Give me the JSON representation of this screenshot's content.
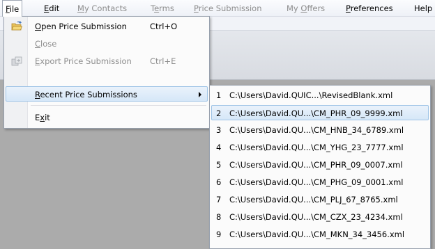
{
  "menubar": {
    "items": [
      {
        "label": "File",
        "underline": "F",
        "rest": "ile",
        "state": "open"
      },
      {
        "label": "Edit",
        "underline": "E",
        "rest": "dit",
        "state": "enabled"
      },
      {
        "label": "My Contacts",
        "underline": "M",
        "rest": "y Contacts",
        "state": "disabled"
      },
      {
        "label": "Terms",
        "underline": "e",
        "pre": "T",
        "rest": "rms",
        "state": "disabled"
      },
      {
        "label": "Price Submission",
        "underline": "P",
        "rest": "rice Submission",
        "state": "disabled"
      },
      {
        "label": "My Offers",
        "pre": "My ",
        "underline": "O",
        "rest": "ffers",
        "state": "disabled"
      },
      {
        "label": "Preferences",
        "underline": "P",
        "rest": "references",
        "state": "enabled"
      },
      {
        "label": "Help",
        "underline": "",
        "rest": "Help",
        "state": "enabled"
      }
    ]
  },
  "file_menu": {
    "open": {
      "underline": "O",
      "rest": "pen Price Submission",
      "shortcut": "Ctrl+O",
      "icon": "open-folder-icon",
      "enabled": true
    },
    "close": {
      "underline": "C",
      "rest": "lose",
      "shortcut": "",
      "enabled": false
    },
    "export": {
      "underline": "E",
      "rest": "xport Price Submission",
      "shortcut": "Ctrl+E",
      "icon": "export-icon",
      "enabled": false
    },
    "recent": {
      "underline": "R",
      "rest": "ecent Price Submissions",
      "enabled": true,
      "highlighted": true
    },
    "exit": {
      "pre": "E",
      "underline": "x",
      "rest": "it",
      "enabled": true
    }
  },
  "recent_menu": {
    "items": [
      {
        "num": "1",
        "path": "C:\\Users\\David.QUIC...\\RevisedBlank.xml",
        "highlighted": false
      },
      {
        "num": "2",
        "path": "C:\\Users\\David.QU...\\CM_PHR_09_9999.xml",
        "highlighted": true
      },
      {
        "num": "3",
        "path": "C:\\Users\\David.QU...\\CM_HNB_34_6789.xml",
        "highlighted": false
      },
      {
        "num": "4",
        "path": "C:\\Users\\David.QU...\\CM_YHG_23_7777.xml",
        "highlighted": false
      },
      {
        "num": "5",
        "path": "C:\\Users\\David.QU...\\CM_PHR_09_0007.xml",
        "highlighted": false
      },
      {
        "num": "6",
        "path": "C:\\Users\\David.QU...\\CM_PHG_09_0001.xml",
        "highlighted": false
      },
      {
        "num": "7",
        "path": "C:\\Users\\David.QU...\\CM_PLJ_67_8765.xml",
        "highlighted": false
      },
      {
        "num": "8",
        "path": "C:\\Users\\David.QU...\\CM_CZX_23_4234.xml",
        "highlighted": false
      },
      {
        "num": "9",
        "path": "C:\\Users\\David.QU...\\CM_MKN_34_3456.xml",
        "highlighted": false
      }
    ]
  },
  "colors": {
    "highlight_fill": "#d6e7f8",
    "highlight_border": "#9ec3e6",
    "disabled_text": "#8d8d8d",
    "workspace": "#ababab"
  }
}
